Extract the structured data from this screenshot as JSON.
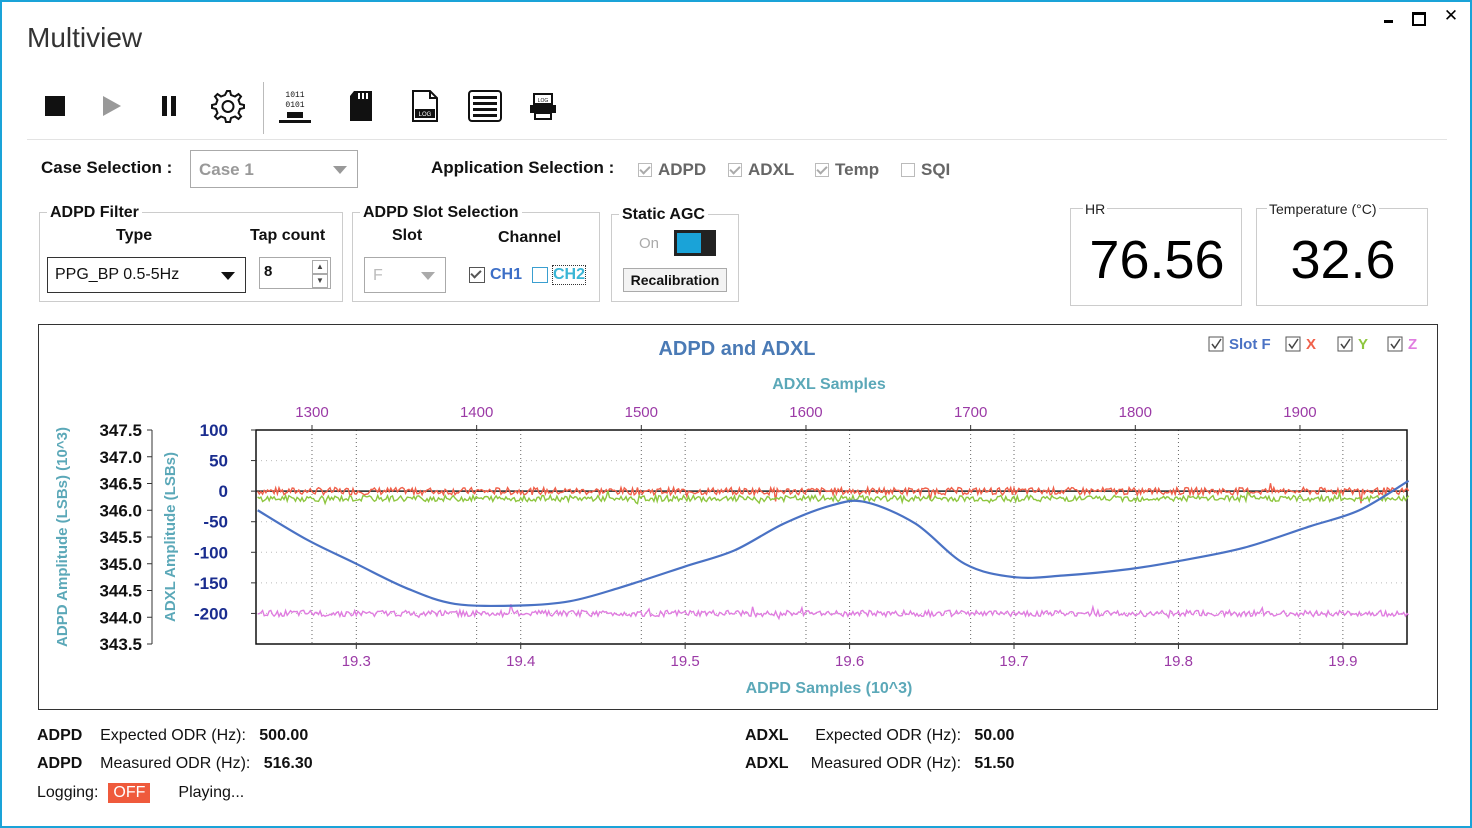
{
  "window": {
    "title": "Multiview",
    "minimize": "▄",
    "maximize": "☐",
    "close": "✕"
  },
  "toolbar": {
    "icons": [
      "stop-icon",
      "play-icon",
      "pause-icon",
      "settings-icon",
      "binary-icon",
      "sd-card-icon",
      "log-file-icon",
      "list-icon",
      "log-printer-icon"
    ],
    "binary_lines": [
      "1011",
      "0101"
    ],
    "log_label": "LOG"
  },
  "case": {
    "label": "Case Selection :",
    "value": "Case 1"
  },
  "app": {
    "label": "Application Selection :",
    "items": [
      {
        "label": "ADPD",
        "checked": true
      },
      {
        "label": "ADXL",
        "checked": true
      },
      {
        "label": "Temp",
        "checked": true
      },
      {
        "label": "SQI",
        "checked": false
      }
    ]
  },
  "adpd_filter": {
    "title": "ADPD Filter",
    "type_label": "Type",
    "tap_label": "Tap count",
    "type_value": "PPG_BP 0.5-5Hz",
    "tap_value": "8"
  },
  "slot_sel": {
    "title": "ADPD Slot Selection",
    "slot_label": "Slot",
    "channel_label": "Channel",
    "slot_value": "F",
    "ch1": "CH1",
    "ch2": "CH2"
  },
  "agc": {
    "title": "Static AGC",
    "on_label": "On",
    "recal": "Recalibration"
  },
  "hr": {
    "label": "HR",
    "value": "76.56"
  },
  "temp": {
    "label": "Temperature (°C)",
    "value": "32.6"
  },
  "chart": {
    "title": "ADPD and ADXL",
    "legend": [
      {
        "label": "Slot F",
        "color": "#4a72c4"
      },
      {
        "label": "X",
        "color": "#f0604a"
      },
      {
        "label": "Y",
        "color": "#8ec63f"
      },
      {
        "label": "Z",
        "color": "#e07de0"
      }
    ]
  },
  "chart_data": {
    "type": "line",
    "title": "ADPD and ADXL",
    "top_xlabel": "ADXL Samples",
    "bottom_xlabel": "ADPD Samples (10^3)",
    "left_ylabel": "ADPD Amplitude (LSBs) (10^3)",
    "right_ylabel": "ADXL Amplitude (LSBs)",
    "top_xticks": [
      "1300",
      "1400",
      "1500",
      "1600",
      "1700",
      "1800",
      "1900"
    ],
    "top_xlim": [
      1266,
      1965
    ],
    "bottom_xticks": [
      "19.3",
      "19.4",
      "19.5",
      "19.6",
      "19.7",
      "19.8",
      "19.9"
    ],
    "bottom_xlim": [
      19.239,
      19.939
    ],
    "adpd_yticks": [
      "347.5",
      "347.0",
      "346.5",
      "346.0",
      "345.5",
      "345.0",
      "344.5",
      "344.0",
      "343.5"
    ],
    "adpd_ylim": [
      343.5,
      347.5
    ],
    "adxl_yticks": [
      "100",
      "50",
      "0",
      "-50",
      "-100",
      "-150",
      "-200"
    ],
    "adxl_ylim": [
      -250,
      100
    ],
    "grid": true,
    "legend_position": "top-right",
    "series": [
      {
        "name": "Slot F",
        "color": "#4a72c4",
        "x": [
          19.24,
          19.27,
          19.3,
          19.33,
          19.36,
          19.4,
          19.43,
          19.46,
          19.5,
          19.53,
          19.56,
          19.59,
          19.61,
          19.64,
          19.67,
          19.7,
          19.73,
          19.77,
          19.8,
          19.84,
          19.88,
          19.91,
          19.94
        ],
        "y": [
          346.0,
          345.45,
          345.0,
          344.55,
          344.25,
          344.22,
          344.3,
          344.55,
          344.95,
          345.25,
          345.75,
          346.1,
          346.15,
          345.75,
          345.0,
          344.75,
          344.78,
          344.9,
          345.05,
          345.3,
          345.7,
          346.0,
          346.55
        ]
      },
      {
        "name": "X",
        "color": "#f0604a",
        "x_range": [
          19.24,
          19.94
        ],
        "level": 0,
        "noise": 6
      },
      {
        "name": "Y",
        "color": "#8ec63f",
        "x_range": [
          19.24,
          19.94
        ],
        "level": -12,
        "noise": 5
      },
      {
        "name": "Z",
        "color": "#e07de0",
        "x_range": [
          19.24,
          19.94
        ],
        "level": -200,
        "noise": 5
      }
    ]
  },
  "status": {
    "adpd_label": "ADPD",
    "adpd_expected_label": "Expected ODR (Hz):",
    "adpd_expected": "500.00",
    "adpd_measured_label": "Measured ODR (Hz):",
    "adpd_measured": "516.30",
    "adxl_label": "ADXL",
    "adxl_expected_label": "Expected ODR (Hz):",
    "adxl_expected": "50.00",
    "adxl_measured_label": "Measured ODR (Hz):",
    "adxl_measured": "51.50",
    "logging_label": "Logging:",
    "logging_value": "OFF",
    "playing": "Playing..."
  }
}
